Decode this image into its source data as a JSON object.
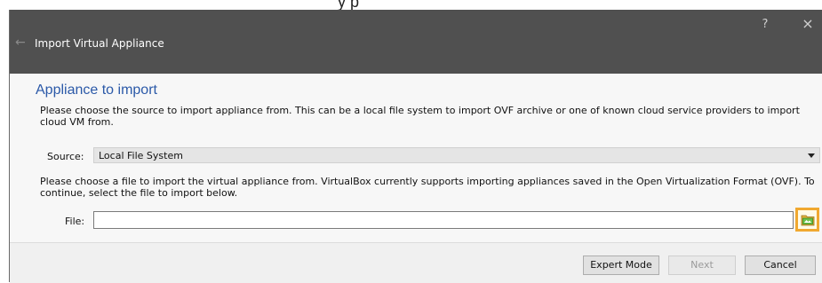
{
  "top_fragment": "y                  p",
  "window": {
    "title": "Import Virtual Appliance",
    "help": "?",
    "close": "×",
    "back": "←"
  },
  "content": {
    "heading": "Appliance to import",
    "source_description": "Please choose the source to import appliance from. This can be a local file system to import OVF archive or one of known cloud service providers to import cloud VM from.",
    "source_label": "Source:",
    "source_value": "Local File System",
    "file_description": "Please choose a file to import the virtual appliance from. VirtualBox currently supports importing appliances saved in the Open Virtualization Format (OVF). To continue, select the file to import below.",
    "file_label": "File:",
    "file_value": ""
  },
  "footer": {
    "expert_mode": "Expert Mode",
    "next": "Next",
    "cancel": "Cancel"
  },
  "colors": {
    "titlebar": "#505050",
    "heading": "#2b59a8",
    "highlight": "#f0a830"
  },
  "icons": {
    "back": "arrow-left-icon",
    "folder": "folder-open-icon",
    "dropdown": "chevron-down-icon"
  }
}
